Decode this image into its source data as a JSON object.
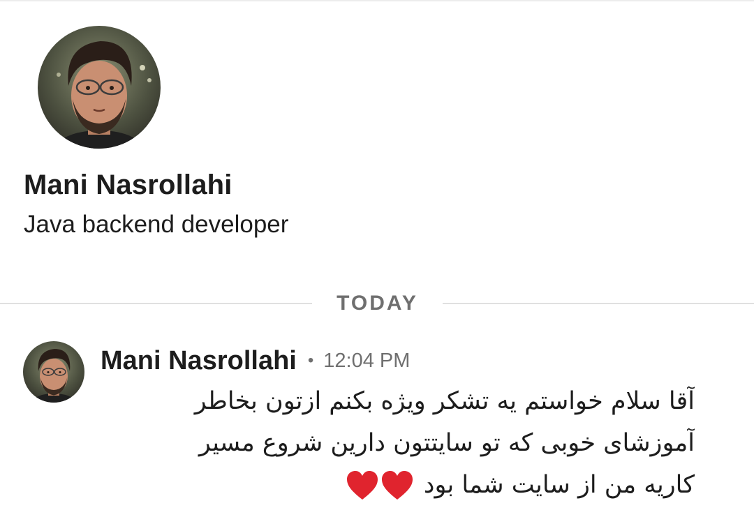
{
  "profile": {
    "avatar_icon": "user-photo",
    "name": "Mani Nasrollahi",
    "title": "Java backend developer"
  },
  "divider": {
    "label": "TODAY"
  },
  "message": {
    "avatar_icon": "user-photo",
    "author": "Mani Nasrollahi",
    "separator": "•",
    "time": "12:04 PM",
    "lines": [
      "آقا سلام خواستم یه تشکر ویژه بکنم ازتون بخاطر",
      "آموزشای خوبی که تو سایتتون دارین شروع مسیر",
      "کاریه من از سایت شما بود"
    ],
    "reaction_icons": [
      "red-heart-icon",
      "red-heart-icon"
    ]
  },
  "colors": {
    "text": "#1d1d1d",
    "muted": "#6f6f6f",
    "divider": "#e0e0e0",
    "heart": "#e0242e"
  }
}
